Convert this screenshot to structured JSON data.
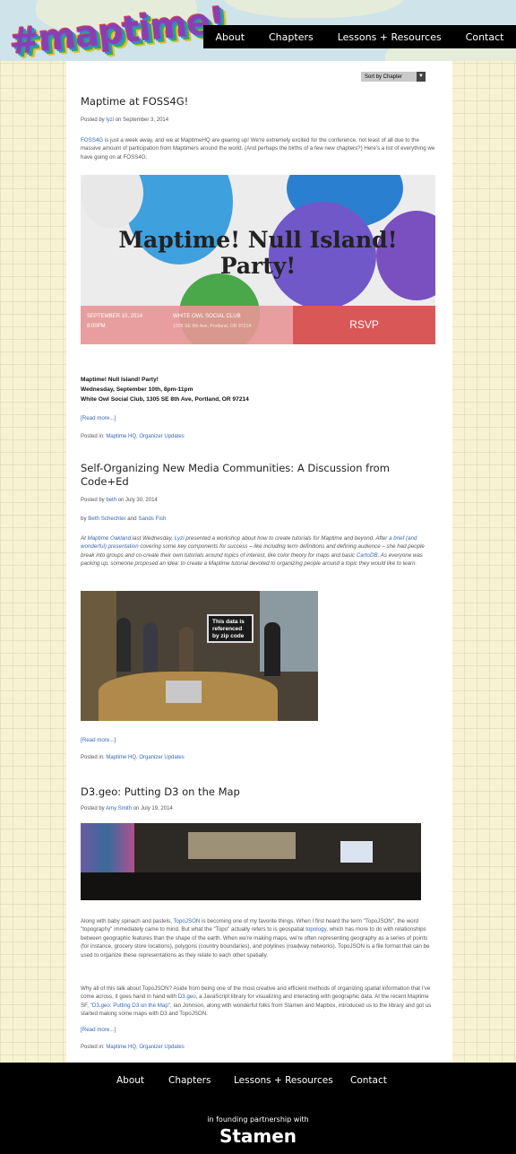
{
  "logo": {
    "text": "#maptime!"
  },
  "nav": [
    "About",
    "Chapters",
    "Lessons + Resources",
    "Contact"
  ],
  "sort_label": "Sort by Chapter",
  "posts": [
    {
      "title": "Maptime at FOSS4G!",
      "meta": {
        "prefix": "Posted by ",
        "author": "lyzi",
        "suffix": " on September 3, 2014"
      },
      "intro": {
        "link": "FOSS4G",
        "text": " is just a week away, and we at MaptimeHQ are gearing up! We're extremely excited for the conference, not least of all due to the massive amount of participation from Maptimers around the world. (And perhaps the births of a few new chapters?) Here's a list of everything we have going on at FOSS4G:"
      },
      "banner": {
        "title": "Maptime! Null Island! Party!",
        "date": "SEPTEMBER 10, 2014",
        "time": "8:00PM",
        "venue": "WHITE OWL SOCIAL CLUB",
        "address": "1305 SE 8th Ave, Portland, OR 97214",
        "rsvp": "RSVP"
      },
      "details": [
        "Maptime! Null Island! Party!",
        "Wednesday, September 10th, 8pm-11pm",
        "White Owl Social Club, 1305 SE 8th Ave, Portland, OR 97214"
      ],
      "read_more": "[Read more...]",
      "posted_in": {
        "prefix": "Posted in: ",
        "links": "Maptime HQ, Organizer Updates"
      }
    },
    {
      "title": "Self-Organizing New Media Communities: A Discussion from Code+Ed",
      "meta": {
        "prefix": "Posted by ",
        "author": "beth",
        "suffix": " on July 30, 2014"
      },
      "byline": {
        "prefix": "by ",
        "a1": "Beth Schechter",
        "mid": " and ",
        "a2": "Sands Fish"
      },
      "body_parts": [
        "At ",
        "Maptime Oakland",
        " last Wednesday, ",
        "Lyzi",
        " presented a workshop about how to create tutorials for Maptime and beyond. After ",
        "a brief (and wonderful) presentation",
        " covering some key components for success – like including term definitions and defining audience – she had people break into groups and co-create their own tutorials around topics of interest, like color theory for maps and basic ",
        "CartoDB",
        ". As everyone was packing up, someone proposed an idea: to create a Maptime tutorial devoted to organizing people around a topic they would like to learn."
      ],
      "photo_caption": "This data is referenced by zip code",
      "read_more": "[Read more...]",
      "posted_in": {
        "prefix": "Posted in: ",
        "links": "Maptime HQ, Organizer Updates"
      }
    },
    {
      "title": "D3.geo: Putting D3 on the Map",
      "meta": {
        "prefix": "Posted by ",
        "author": "Amy Smith",
        "suffix": " on July 19, 2014"
      },
      "p1_parts": [
        "Along with baby spinach and pastels, ",
        "TopoJSON",
        " is becoming one of my favorite things. When I first heard the term \"TopoJSON\", the word \"topography\" immediately came to mind. But what the \"Topo\" actually refers to is geospatial ",
        "topology",
        ", which has more to do with relationships between geographic features than the shape of the earth. When we're making maps, we're often representing geography as a series of points (for instance, grocery store locations), polygons (country boundaries), and polylines (roadway networks). TopoJSON is a file format that can be used to organize these representations as they relate to each other spatially."
      ],
      "p2_parts": [
        "Why all of this talk about TopoJSON? Aside from being one of the most creative and efficient methods of organizing spatial information that I've come across, it goes hand in hand with ",
        "D3.geo",
        ", a JavaScript library for visualizing and interacting with geographic data. At the recent Maptime SF, \"",
        "D3.geo: Putting D3 on the Map",
        "\", Ian Johnson, along with wonderful folks from Stamen and Mapbox, introduced us to the library and got us started making some maps with D3 and TopoJSON."
      ],
      "read_more": "[Read more...]",
      "posted_in": {
        "prefix": "Posted in: ",
        "links": "Maptime HQ, Organizer Updates"
      }
    }
  ],
  "footer": {
    "nav": [
      "About",
      "Chapters",
      "Lessons + Resources",
      "Contact"
    ],
    "partnership": "in founding partnership with",
    "partner_name": "Stamen"
  }
}
